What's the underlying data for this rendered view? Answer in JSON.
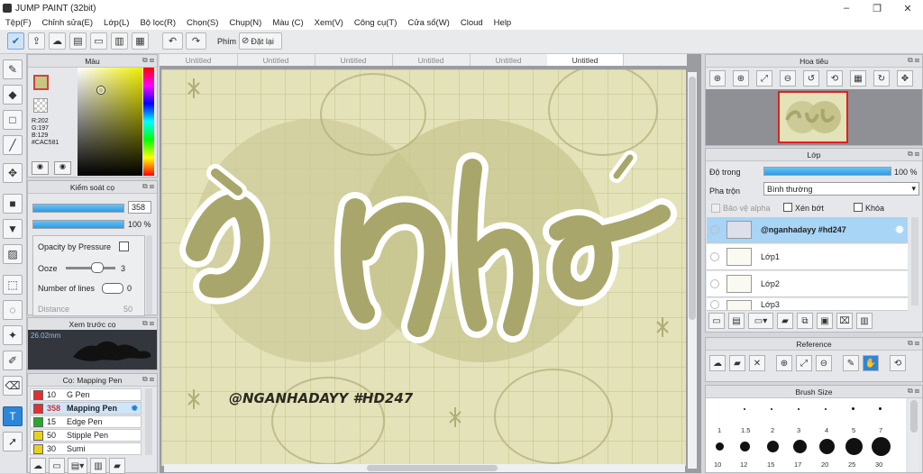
{
  "app": {
    "title": "JUMP PAINT (32bit)"
  },
  "window_controls": {
    "minimize": "–",
    "restore": "❐",
    "close": "✕"
  },
  "menu": [
    "Tệp(F)",
    "Chỉnh sửa(E)",
    "Lớp(L)",
    "Bộ lọc(R)",
    "Chọn(S)",
    "Chụp(N)",
    "Màu (C)",
    "Xem(V)",
    "Công cụ(T)",
    "Cửa sổ(W)",
    "Cloud",
    "Help"
  ],
  "toolbar": {
    "phim_label": "Phím",
    "reset_label": "Đặt lại"
  },
  "color_panel": {
    "title": "Màu",
    "r": "R:202",
    "g": "G:197",
    "b": "B:129",
    "hex": "#CAC581",
    "accent": "#CAC581"
  },
  "brush_control": {
    "title": "Kiểm soát cọ",
    "size": "358",
    "opacity": "100 %",
    "opacity_pressure_label": "Opacity by Pressure",
    "ooze_label": "Ooze",
    "ooze_value": "3",
    "lines_label": "Number of lines",
    "lines_value": "0",
    "hidden_label": "Distance",
    "hidden_value": "50"
  },
  "preview": {
    "title": "Xem trước cọ",
    "size": "26.02mm"
  },
  "pen_list": {
    "title": "Cọ: Mapping Pen",
    "items": [
      {
        "num": "10",
        "name": "G Pen",
        "color": "#e03030"
      },
      {
        "num": "358",
        "name": "Mapping Pen",
        "color": "#e03030"
      },
      {
        "num": "15",
        "name": "Edge Pen",
        "color": "#28a828"
      },
      {
        "num": "50",
        "name": "Stipple Pen",
        "color": "#e8d020"
      },
      {
        "num": "30",
        "name": "Sumi",
        "color": "#e8d020"
      }
    ]
  },
  "tabs": [
    "Untitled",
    "Untitled",
    "Untitled",
    "Untitled",
    "Untitled",
    "Untitled"
  ],
  "canvas": {
    "big_text": "ầ nhớ",
    "signature": "@NGANHADAYY #HD247"
  },
  "navigator": {
    "title": "Hoa tiêu"
  },
  "layer_panel": {
    "title": "Lớp",
    "opacity_label": "Độ trong",
    "opacity_value": "100 %",
    "blend_label": "Pha trộn",
    "blend_value": "Bình thường",
    "protect_alpha": "Bảo vệ alpha",
    "clipping": "Xén bớt",
    "lock": "Khóa",
    "layers": [
      {
        "name": "@nganhadayy #hd247"
      },
      {
        "name": "Lớp1"
      },
      {
        "name": "Lớp2"
      },
      {
        "name": "Lớp3"
      }
    ]
  },
  "reference_panel": {
    "title": "Reference"
  },
  "brush_size_panel": {
    "title": "Brush Size",
    "labels": [
      "1",
      "1.5",
      "2",
      "3",
      "4",
      "5",
      "7",
      "10",
      "12",
      "15",
      "17",
      "20",
      "25",
      "30"
    ]
  }
}
